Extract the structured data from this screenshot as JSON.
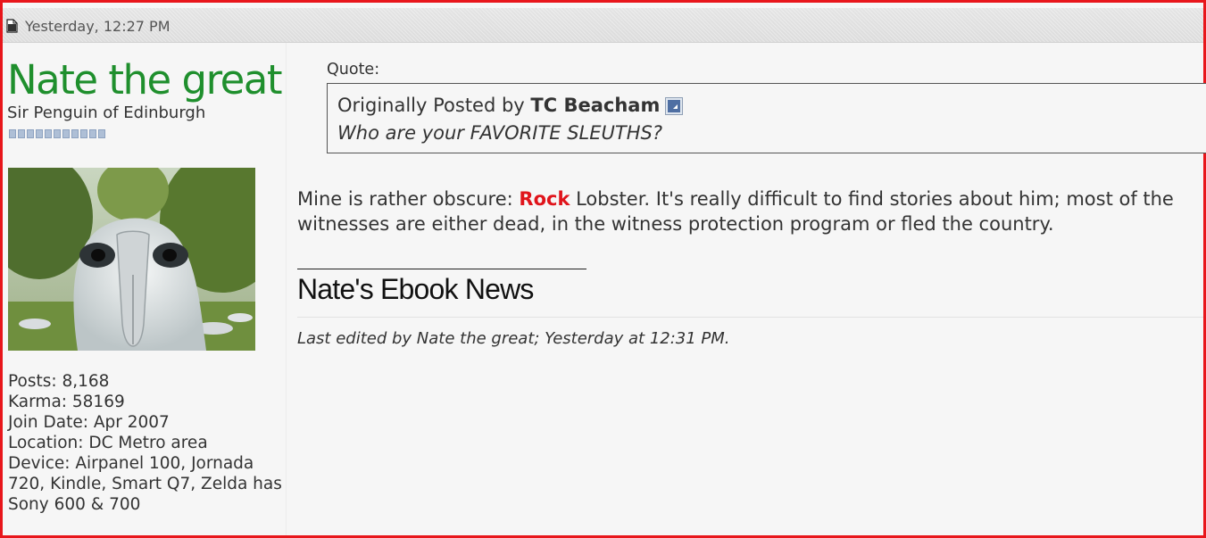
{
  "post_header": {
    "icon": "document-icon",
    "date": "Yesterday, 12:27 PM"
  },
  "author": {
    "username": "Nate the great",
    "title": "Sir Penguin of Edinburgh",
    "reputation_pips": 11,
    "avatar": "albatross-avatar",
    "stats": {
      "posts": "Posts: 8,168",
      "karma": "Karma: 58169",
      "join_date": "Join Date: Apr 2007",
      "location": "Location: DC Metro area",
      "device": "Device: Airpanel 100, Jornada 720, Kindle, Smart Q7, Zelda has Sony 600 & 700"
    }
  },
  "quote": {
    "label": "Quote:",
    "prefix": "Originally Posted by ",
    "author": "TC Beacham",
    "view_icon": "view-post-icon",
    "text": "Who are your FAVORITE SLEUTHS?"
  },
  "message": {
    "before": "Mine is rather obscure: ",
    "highlight": "Rock",
    "after": " Lobster. It's really difficult to find stories about him; most of the witnesses are either dead, in the witness protection program or fled the country."
  },
  "signature": {
    "link_text": "Nate's Ebook News"
  },
  "edit_note": "Last edited by Nate the great; Yesterday at 12:31 PM.",
  "colors": {
    "frame": "#e8161b",
    "username": "#1f8f2d",
    "highlight": "#e0141b",
    "background": "#f6f6f6"
  }
}
